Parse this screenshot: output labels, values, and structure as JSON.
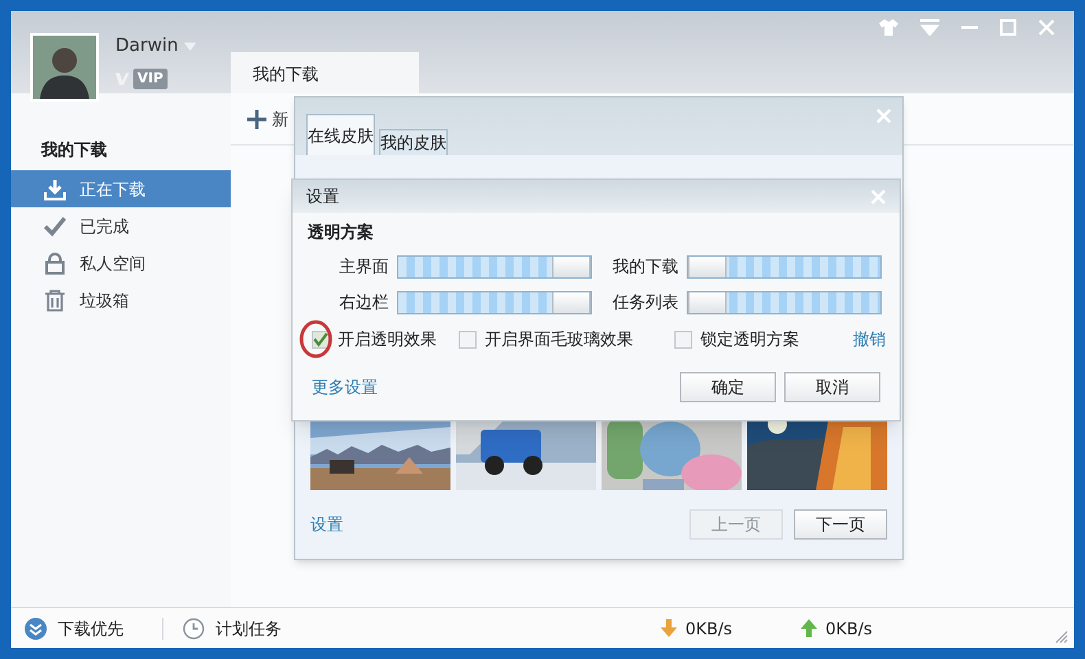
{
  "user": {
    "name": "Darwin",
    "badge": "VIP"
  },
  "tabs": [
    {
      "label": "我的下载",
      "selected": true
    }
  ],
  "toolbar": {
    "new_label": "新"
  },
  "sidebar": {
    "heading": "我的下载",
    "items": [
      {
        "label": "正在下载",
        "selected": true
      },
      {
        "label": "已完成",
        "selected": false
      },
      {
        "label": "私人空间",
        "selected": false
      },
      {
        "label": "垃圾箱",
        "selected": false
      }
    ]
  },
  "skin_dialog": {
    "tabs": [
      {
        "label": "在线皮肤",
        "selected": true
      },
      {
        "label": "我的皮肤",
        "selected": false
      }
    ],
    "thumbnails": [
      {
        "kind": "landscape"
      },
      {
        "kind": "car"
      },
      {
        "kind": "candy"
      },
      {
        "kind": "night"
      }
    ],
    "settings_link": "设置",
    "buttons": [
      {
        "label": "上一页",
        "disabled": true
      },
      {
        "label": "下一页",
        "disabled": false
      }
    ]
  },
  "settings_dialog": {
    "title": "设置",
    "section": "透明方案",
    "sliders": [
      {
        "label": "主界面",
        "level": 1
      },
      {
        "label": "我的下载",
        "level": 0
      },
      {
        "label": "右边栏",
        "level": 1
      },
      {
        "label": "任务列表",
        "level": 0
      }
    ],
    "options": [
      {
        "label": "开启透明效果",
        "checked": true
      },
      {
        "label": "开启界面毛玻璃效果",
        "checked": false
      },
      {
        "label": "锁定透明方案",
        "checked": false
      }
    ],
    "undo_link": "撤销",
    "more_link": "更多设置",
    "buttons": [
      "确定",
      "取消"
    ]
  },
  "status_bar": {
    "priority": "下载优先",
    "schedule": "计划任务",
    "down_speed": "0KB/s",
    "up_speed": "0KB/s"
  }
}
